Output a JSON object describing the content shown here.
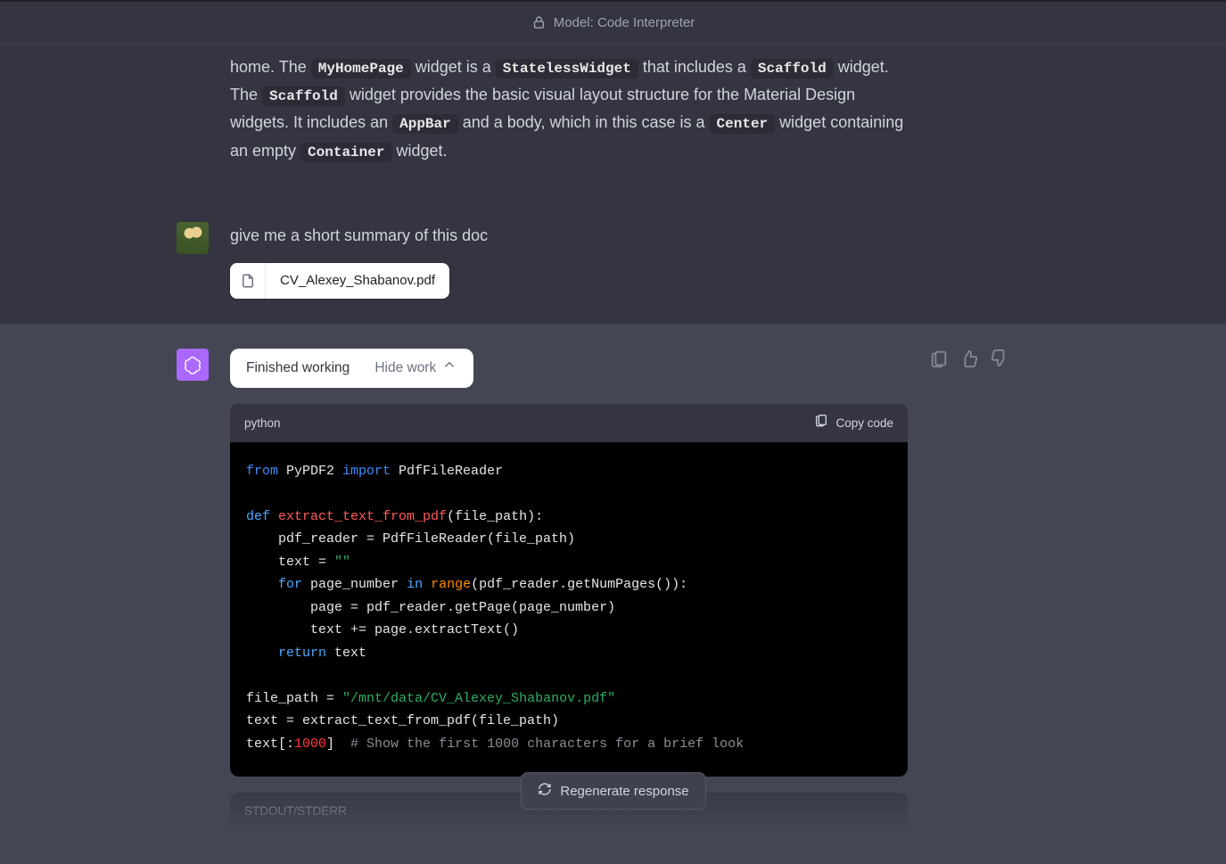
{
  "header": {
    "model_label": "Model: Code Interpreter"
  },
  "prev_assistant": {
    "frag1": "home. The ",
    "code1": "MyHomePage",
    "frag2": " widget is a ",
    "code2": "StatelessWidget",
    "frag3": " that includes a ",
    "code3": "Scaffold",
    "frag4": " widget. The ",
    "code4": "Scaffold",
    "frag5": " widget provides the basic visual layout structure for the Material Design widgets. It includes an ",
    "code5": "AppBar",
    "frag6": " and a body, which in this case is a ",
    "code6": "Center",
    "frag7": " widget containing an empty ",
    "code7": "Container",
    "frag8": " widget."
  },
  "user": {
    "message": "give me a short summary of this doc",
    "attachment": "CV_Alexey_Shabanov.pdf"
  },
  "assistant": {
    "status": "Finished working",
    "toggle": "Hide work",
    "code_lang": "python",
    "copy_label": "Copy code",
    "code": {
      "l1a": "from",
      "l1b": " PyPDF2 ",
      "l1c": "import",
      "l1d": " PdfFileReader",
      "l3a": "def",
      "l3b": " ",
      "l3c": "extract_text_from_pdf",
      "l3d": "(file_path):",
      "l4": "    pdf_reader = PdfFileReader(file_path)",
      "l5a": "    text = ",
      "l5b": "\"\"",
      "l6a": "    ",
      "l6b": "for",
      "l6c": " page_number ",
      "l6d": "in",
      "l6e": " ",
      "l6f": "range",
      "l6g": "(pdf_reader.getNumPages()):",
      "l7": "        page = pdf_reader.getPage(page_number)",
      "l8": "        text += page.extractText()",
      "l9a": "    ",
      "l9b": "return",
      "l9c": " text",
      "l11a": "file_path = ",
      "l11b": "\"/mnt/data/CV_Alexey_Shabanov.pdf\"",
      "l12": "text = extract_text_from_pdf(file_path)",
      "l13a": "text[:",
      "l13b": "1000",
      "l13c": "]  ",
      "l13d": "# Show the first 1000 characters for a brief look"
    },
    "stdout_label": "STDOUT/STDERR"
  },
  "regen": "Regenerate response"
}
